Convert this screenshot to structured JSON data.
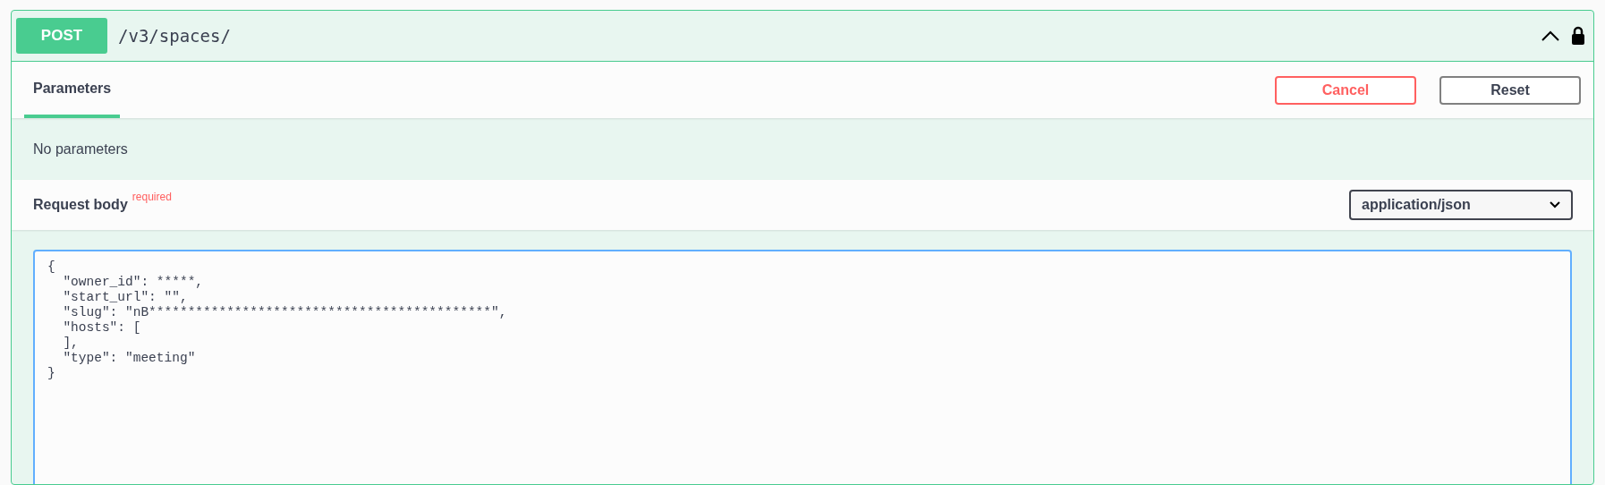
{
  "operation": {
    "method": "POST",
    "path": "/v3/spaces/"
  },
  "tabs": [
    {
      "label": "Parameters",
      "selected": true
    }
  ],
  "buttons": [
    {
      "kind": "cancel",
      "label": "Cancel"
    },
    {
      "kind": "reset",
      "label": "Reset"
    }
  ],
  "parameters": {
    "message": "No parameters"
  },
  "request_body": {
    "label": "Request body",
    "required_label": "required",
    "content_type": "application/json",
    "editor_value": "{\n  \"owner_id\": *****,\n  \"start_url\": \"\",\n  \"slug\": \"nB********************************************\",\n  \"hosts\": [\n  ],\n  \"type\": \"meeting\"\n}"
  }
}
